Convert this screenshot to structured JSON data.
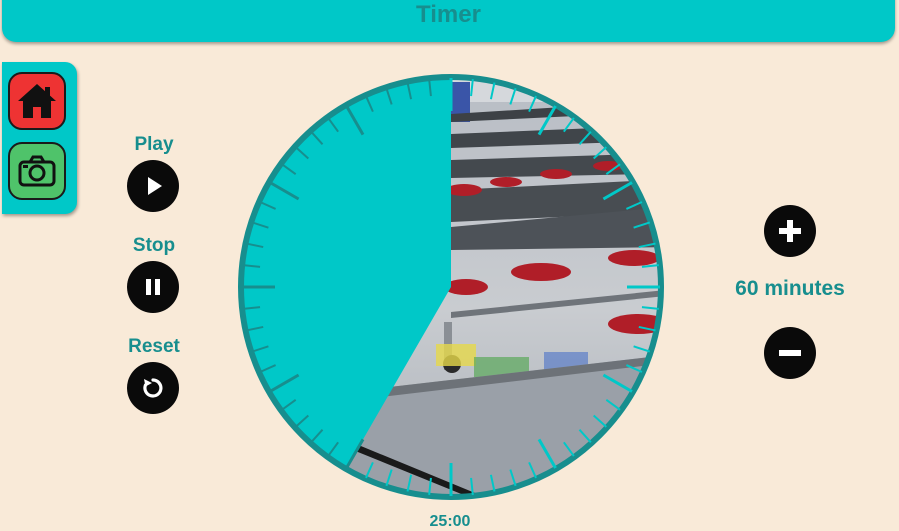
{
  "header": {
    "title": "Timer"
  },
  "sidebar": {
    "home_icon": "home-icon",
    "camera_icon": "camera-icon"
  },
  "controls": {
    "play_label": "Play",
    "stop_label": "Stop",
    "reset_label": "Reset"
  },
  "duration": {
    "minutes_label": "60 minutes",
    "increase_icon": "plus-icon",
    "decrease_icon": "minus-icon",
    "total_minutes": 60
  },
  "timer": {
    "remaining_display": "25:00",
    "remaining_minutes": 25,
    "ticks": 60
  },
  "colors": {
    "accent": "#00c8c8",
    "text_accent": "#178e8e",
    "background": "#f9ead8",
    "home_button": "#ee3333",
    "camera_button": "#4fc36a",
    "control_button": "#0a0a0a"
  }
}
